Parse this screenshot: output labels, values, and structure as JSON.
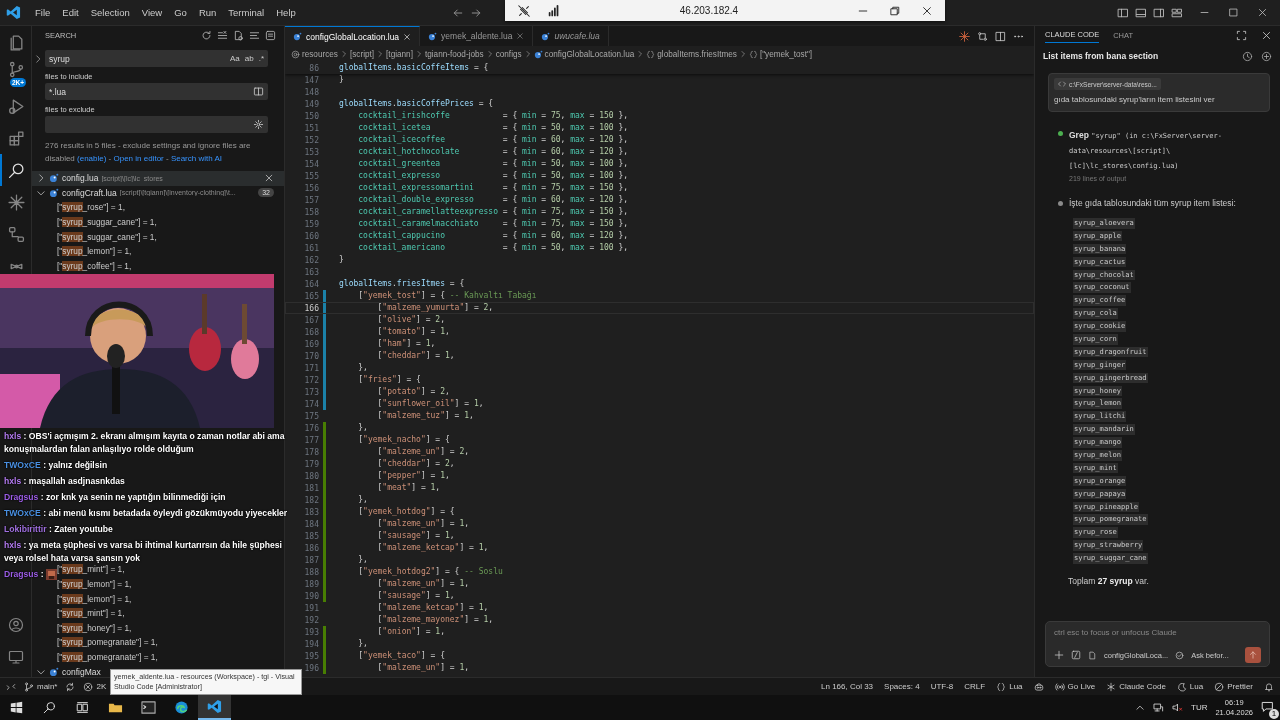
{
  "menu": [
    "File",
    "Edit",
    "Selection",
    "View",
    "Go",
    "Run",
    "Terminal",
    "Help"
  ],
  "remote_bar": {
    "address": "46.203.182.4"
  },
  "activity_bar": {
    "items": [
      {
        "kind": "files",
        "selected": false
      },
      {
        "kind": "source-control",
        "selected": false,
        "badge": "2K+"
      },
      {
        "kind": "run",
        "selected": false
      },
      {
        "kind": "extensions",
        "selected": false
      },
      {
        "kind": "search",
        "selected": true
      },
      {
        "kind": "spark",
        "selected": false
      },
      {
        "kind": "remote",
        "selected": false
      },
      {
        "kind": "test",
        "selected": false
      }
    ],
    "bottom": [
      {
        "kind": "account"
      },
      {
        "kind": "monitor"
      }
    ]
  },
  "search": {
    "title": "SEARCH",
    "query": "syrup",
    "toggles": [
      "Aa",
      "ab",
      ".*"
    ],
    "include_label": "files to include",
    "include": "*.lua",
    "exclude_label": "files to exclude",
    "message": [
      {
        "kind": "text",
        "text": "276 results in 5 files - exclude settings and ignore files are disabled "
      },
      {
        "kind": "link",
        "text": "(enable)"
      },
      {
        "kind": "text",
        "text": " - "
      },
      {
        "kind": "link",
        "text": "Open in editor"
      },
      {
        "kind": "text",
        "text": " - "
      },
      {
        "kind": "link",
        "text": "Search with AI"
      }
    ],
    "files": [
      {
        "name": "config.lua",
        "path": "[script]\\[lc]\\lc_stores",
        "expanded": false,
        "hovered": true
      },
      {
        "name": "configCraft.lua",
        "path": "[script]\\[tgiann]\\[inventory-clothing]\\t...",
        "count": "32",
        "expanded": true,
        "hovered": false,
        "matches_top": [
          {
            "before": "[\"",
            "match": "syrup",
            "after": "_rose\"] = 1,"
          },
          {
            "before": "[\"",
            "match": "syrup",
            "after": "_suggar_cane\"] = 1,"
          },
          {
            "before": "[\"",
            "match": "syrup",
            "after": "_suggar_cane\"] = 1,"
          },
          {
            "before": "[\"",
            "match": "syrup",
            "after": "_lemon\"] = 1,"
          },
          {
            "before": "[\"",
            "match": "syrup",
            "after": "_coffee\"] = 1,"
          }
        ],
        "matches_bottom": [
          {
            "before": "[\"",
            "match": "syrup",
            "after": "_mint\"] = 1,"
          },
          {
            "before": "[\"",
            "match": "syrup",
            "after": "_lemon\"] = 1,"
          },
          {
            "before": "[\"",
            "match": "syrup",
            "after": "_lemon\"] = 1,"
          },
          {
            "before": "[\"",
            "match": "syrup",
            "after": "_mint\"] = 1,"
          },
          {
            "before": "[\"",
            "match": "syrup",
            "after": "_honey\"] = 1,"
          },
          {
            "before": "[\"",
            "match": "syrup",
            "after": "_pomegranate\"] = 1,"
          },
          {
            "before": "[\"",
            "match": "syrup",
            "after": "_pomegranate\"] = 1,"
          }
        ]
      },
      {
        "name": "configMax",
        "expanded": true,
        "hovered": false
      }
    ]
  },
  "chat": [
    {
      "user": "hxls",
      "color": "#b57cf2",
      "text": ": OBS'i açmışım 2. ekranı almışım kayıta o zaman notlar abi ama konuşmalardan falan anlaşılıyo rolde olduğum",
      "emote": false
    },
    {
      "user": "TWOxCE",
      "color": "#4a90e2",
      "text": ": yalnız değilsin",
      "emote": false
    },
    {
      "user": "hxls",
      "color": "#b57cf2",
      "text": ": maşallah asdjnasnkdas",
      "emote": false
    },
    {
      "user": "Dragsus",
      "color": "#9b5de5",
      "text": ": zor knk ya senin ne yaptığın bilinmediği için",
      "emote": false
    },
    {
      "user": "TWOxCE",
      "color": "#4a90e2",
      "text": ": abi menü kısmı betadada öyleydi gözükmüyodu yiyecekler",
      "emote": false
    },
    {
      "user": "Lokibirittir",
      "color": "#a070e0",
      "text": ": Zaten youtube",
      "emote": false
    },
    {
      "user": "hxls",
      "color": "#b57cf2",
      "text": ": ya meta şüphesi vs varsa bi ihtimal kurtarırsın da hile şüphesi veya rolsel hata varsa şansın yok",
      "emote": false
    },
    {
      "user": "Dragsus",
      "color": "#9b5de5",
      "text": ":",
      "emote": true
    }
  ],
  "editor": {
    "tabs": [
      {
        "label": "configGlobalLocation.lua",
        "selected": true,
        "preview": false
      },
      {
        "label": "yemek_aldente.lua",
        "selected": false,
        "preview": false
      },
      {
        "label": "uwucafe.lua",
        "selected": false,
        "preview": true
      }
    ],
    "breadcrumb": [
      {
        "kind": "folder",
        "text": "resources"
      },
      {
        "kind": "folder",
        "text": "[script]"
      },
      {
        "kind": "folder",
        "text": "[tgiann]"
      },
      {
        "kind": "folder",
        "text": "tgiann-food-jobs"
      },
      {
        "kind": "folder",
        "text": "configs"
      },
      {
        "kind": "file",
        "text": "configGlobalLocation.lua"
      },
      {
        "kind": "symbol",
        "text": "globalItems.friesItmes"
      },
      {
        "kind": "symbol",
        "text": "[\"yemek_tost\"]"
      }
    ],
    "sticky_line": {
      "n": "86",
      "code": "globalItems.basicCoffeItems = {"
    },
    "lines": [
      {
        "n": "147",
        "code": "}",
        "current": false,
        "modified": false,
        "added": false
      },
      {
        "n": "148",
        "current": false,
        "modified": false,
        "added": false
      },
      {
        "n": "149",
        "code": "globalItems.basicCoffePrices = {",
        "current": false,
        "modified": false,
        "added": false
      },
      {
        "n": "150",
        "code": "    cocktail_irishcoffe           = { min = 75, max = 150 },",
        "current": false,
        "modified": false,
        "added": false
      },
      {
        "n": "151",
        "code": "    cocktail_icetea               = { min = 50, max = 100 },",
        "current": false,
        "modified": false,
        "added": false
      },
      {
        "n": "152",
        "code": "    cocktail_icecoffee            = { min = 60, max = 120 },",
        "current": false,
        "modified": false,
        "added": false
      },
      {
        "n": "153",
        "code": "    cocktail_hotchocolate         = { min = 60, max = 120 },",
        "current": false,
        "modified": false,
        "added": false
      },
      {
        "n": "154",
        "code": "    cocktail_greentea             = { min = 50, max = 100 },",
        "current": false,
        "modified": false,
        "added": false
      },
      {
        "n": "155",
        "code": "    cocktail_expresso             = { min = 50, max = 100 },",
        "current": false,
        "modified": false,
        "added": false
      },
      {
        "n": "156",
        "code": "    cocktail_expressomartini      = { min = 75, max = 150 },",
        "current": false,
        "modified": false,
        "added": false
      },
      {
        "n": "157",
        "code": "    cocktail_double_expresso      = { min = 60, max = 120 },",
        "current": false,
        "modified": false,
        "added": false
      },
      {
        "n": "158",
        "code": "    cocktail_caramellatteexpresso = { min = 75, max = 150 },",
        "current": false,
        "modified": false,
        "added": false
      },
      {
        "n": "159",
        "code": "    cocktail_caramelmacchiato     = { min = 75, max = 150 },",
        "current": false,
        "modified": false,
        "added": false
      },
      {
        "n": "160",
        "code": "    cocktail_cappucino            = { min = 60, max = 120 },",
        "current": false,
        "modified": false,
        "added": false
      },
      {
        "n": "161",
        "code": "    cocktail_americano            = { min = 50, max = 100 },",
        "current": false,
        "modified": false,
        "added": false
      },
      {
        "n": "162",
        "code": "}",
        "current": false,
        "modified": false,
        "added": false
      },
      {
        "n": "163",
        "current": false,
        "modified": false,
        "added": false
      },
      {
        "n": "164",
        "code": "globalItems.friesItmes = {",
        "current": false,
        "modified": false,
        "added": false
      },
      {
        "n": "165",
        "code": "    [\"yemek_tost\"] = { -- Kahvaltı Tabağı",
        "current": false,
        "modified": true,
        "added": false
      },
      {
        "n": "166",
        "code": "        [\"malzeme_yumurta\"] = 2,",
        "current": true,
        "modified": true,
        "added": false
      },
      {
        "n": "167",
        "code": "        [\"olive\"] = 2,",
        "current": false,
        "modified": true,
        "added": false
      },
      {
        "n": "168",
        "code": "        [\"tomato\"] = 1,",
        "current": false,
        "modified": true,
        "added": false
      },
      {
        "n": "169",
        "code": "        [\"ham\"] = 1,",
        "current": false,
        "modified": true,
        "added": false
      },
      {
        "n": "170",
        "code": "        [\"cheddar\"] = 1,",
        "current": false,
        "modified": true,
        "added": false
      },
      {
        "n": "171",
        "code": "    },",
        "current": false,
        "modified": true,
        "added": false
      },
      {
        "n": "172",
        "code": "    [\"fries\"] = {",
        "current": false,
        "modified": true,
        "added": false
      },
      {
        "n": "173",
        "code": "        [\"potato\"] = 2,",
        "current": false,
        "modified": true,
        "added": false
      },
      {
        "n": "174",
        "code": "        [\"sunflower_oil\"] = 1,",
        "current": false,
        "modified": true,
        "added": false
      },
      {
        "n": "175",
        "code": "        [\"malzeme_tuz\"] = 1,",
        "current": false,
        "modified": false,
        "added": false
      },
      {
        "n": "176",
        "code": "    },",
        "current": false,
        "modified": false,
        "added": true
      },
      {
        "n": "177",
        "code": "    [\"yemek_nacho\"] = {",
        "current": false,
        "modified": false,
        "added": true
      },
      {
        "n": "178",
        "code": "        [\"malzeme_un\"] = 2,",
        "current": false,
        "modified": false,
        "added": true
      },
      {
        "n": "179",
        "code": "        [\"cheddar\"] = 2,",
        "current": false,
        "modified": false,
        "added": true
      },
      {
        "n": "180",
        "code": "        [\"pepper\"] = 1,",
        "current": false,
        "modified": false,
        "added": true
      },
      {
        "n": "181",
        "code": "        [\"meat\"] = 1,",
        "current": false,
        "modified": false,
        "added": true
      },
      {
        "n": "182",
        "code": "    },",
        "current": false,
        "modified": false,
        "added": true
      },
      {
        "n": "183",
        "code": "    [\"yemek_hotdog\"] = {",
        "current": false,
        "modified": false,
        "added": true
      },
      {
        "n": "184",
        "code": "        [\"malzeme_un\"] = 1,",
        "current": false,
        "modified": false,
        "added": true
      },
      {
        "n": "185",
        "code": "        [\"sausage\"] = 1,",
        "current": false,
        "modified": false,
        "added": true
      },
      {
        "n": "186",
        "code": "        [\"malzeme_ketcap\"] = 1,",
        "current": false,
        "modified": false,
        "added": true
      },
      {
        "n": "187",
        "code": "    },",
        "current": false,
        "modified": false,
        "added": true
      },
      {
        "n": "188",
        "code": "    [\"yemek_hotdog2\"] = { -- Soslu",
        "current": false,
        "modified": false,
        "added": true
      },
      {
        "n": "189",
        "code": "        [\"malzeme_un\"] = 1,",
        "current": false,
        "modified": false,
        "added": true
      },
      {
        "n": "190",
        "code": "        [\"sausage\"] = 1,",
        "current": false,
        "modified": false,
        "added": true
      },
      {
        "n": "191",
        "code": "        [\"malzeme_ketcap\"] = 1,",
        "current": false,
        "modified": false,
        "added": false
      },
      {
        "n": "192",
        "code": "        [\"malzeme_mayonez\"] = 1,",
        "current": false,
        "modified": false,
        "added": false
      },
      {
        "n": "193",
        "code": "        [\"onion\"] = 1,",
        "current": false,
        "modified": false,
        "added": true
      },
      {
        "n": "194",
        "code": "    },",
        "current": false,
        "modified": false,
        "added": true
      },
      {
        "n": "195",
        "code": "    [\"yemek_taco\"] = {",
        "current": false,
        "modified": false,
        "added": true
      },
      {
        "n": "196",
        "code": "        [\"malzeme_un\"] = 1,",
        "current": false,
        "modified": false,
        "added": true
      }
    ]
  },
  "claude": {
    "tabs": [
      {
        "label": "CLAUDE CODE",
        "selected": true
      },
      {
        "label": "CHAT",
        "selected": false
      }
    ],
    "title": "List items from bana section",
    "prompt": {
      "file": "c:\\FxServer\\server-data\\reso...",
      "text": "gıda tablosundaki syrup'ların item listesini ver"
    },
    "steps": [
      {
        "color": "#4caf50",
        "tool": "Grep",
        "args": "\"syrup\" (in c:\\FxServer\\server-data\\resources\\[script]\\[lc]\\lc_stores\\config.lua)",
        "note": "219 lines of output"
      },
      {
        "color": "#8a8a8a",
        "text": "İşte gıda tablosundaki tüm syrup item listesi:"
      }
    ],
    "items": [
      "syrup_aloevera",
      "syrup_apple",
      "syrup_banana",
      "syrup_cactus",
      "syrup_chocolat",
      "syrup_coconut",
      "syrup_coffee",
      "syrup_cola",
      "syrup_cookie",
      "syrup_corn",
      "syrup_dragonfruit",
      "syrup_ginger",
      "syrup_gingerbread",
      "syrup_honey",
      "syrup_lemon",
      "syrup_litchi",
      "syrup_mandarin",
      "syrup_mango",
      "syrup_melon",
      "syrup_mint",
      "syrup_orange",
      "syrup_papaya",
      "syrup_pineapple",
      "syrup_pomegranate",
      "syrup_rose",
      "syrup_strawberry",
      "syrup_suggar_cane"
    ],
    "summary": "Toplam **27 syrup** var.",
    "input": {
      "placeholder": "ctrl esc to focus or unfocus Claude",
      "file": "configGlobalLoca...",
      "mode": "Ask befor..."
    }
  },
  "tooltip": "yemek_aldente.lua - resources (Workspace) - tgi - Visual Studio Code [Administrator]",
  "status": {
    "branch": "main*",
    "problems": "2K",
    "right": [
      {
        "kind": "text",
        "text": "Ln 166, Col 33"
      },
      {
        "kind": "text",
        "text": "Spaces: 4"
      },
      {
        "kind": "text",
        "text": "UTF-8"
      },
      {
        "kind": "text",
        "text": "CRLF"
      },
      {
        "kind": "braces",
        "text": "Lua"
      },
      {
        "kind": "copilot"
      },
      {
        "kind": "broadcast",
        "text": "Go Live"
      },
      {
        "kind": "asterisk",
        "text": "Claude Code"
      },
      {
        "kind": "moon",
        "text": "Lua"
      },
      {
        "kind": "blocked",
        "text": "Prettier"
      },
      {
        "kind": "bell"
      }
    ]
  },
  "taskbar": {
    "apps": [
      {
        "kind": "explorer",
        "active": false
      },
      {
        "kind": "terminal",
        "active": false
      },
      {
        "kind": "edge",
        "active": false
      },
      {
        "kind": "vscode",
        "active": true
      }
    ],
    "language": "TUR",
    "time": "06:19",
    "date": "21.04.2026",
    "notifications": "1"
  }
}
